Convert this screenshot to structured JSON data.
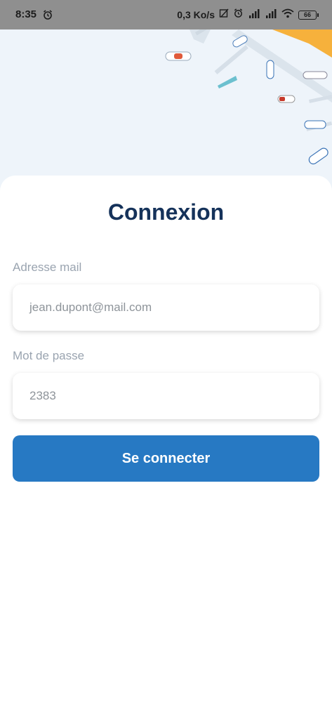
{
  "status_bar": {
    "time": "8:35",
    "network_speed": "0,3 Ko/s",
    "battery_level": "66",
    "icons": [
      "alarm-icon",
      "notification-icon",
      "alarm-icon",
      "signal-icon",
      "signal-icon",
      "wifi-icon",
      "battery-icon"
    ]
  },
  "hero": {
    "illustration": "marina-boats-illustration"
  },
  "login": {
    "title": "Connexion",
    "email_label": "Adresse mail",
    "email_placeholder": "jean.dupont@mail.com",
    "password_label": "Mot de passe",
    "password_value": "2383",
    "submit_label": "Se connecter"
  },
  "colors": {
    "title": "#15325a",
    "primary_button": "#2779c3",
    "label": "#9aa4b0",
    "hero_background": "#eef4fa"
  }
}
